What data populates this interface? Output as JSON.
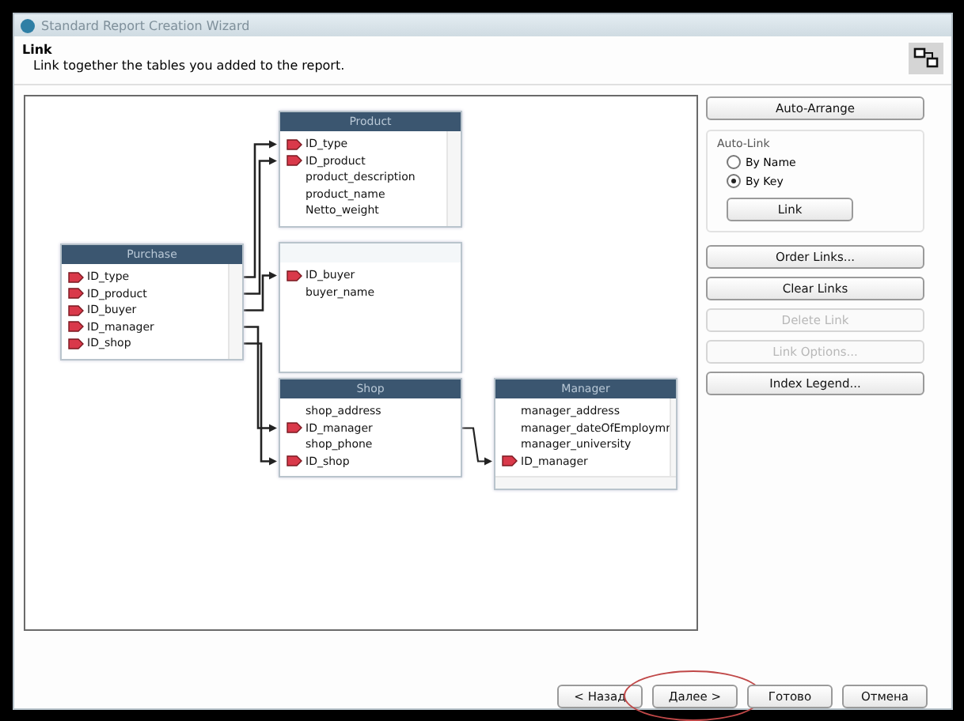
{
  "window": {
    "title": "Standard Report Creation Wizard"
  },
  "header": {
    "title": "Link",
    "subtitle": "Link together the tables you added to the report."
  },
  "tables": [
    {
      "title": "Product",
      "fields": [
        {
          "name": "ID_type",
          "key": true
        },
        {
          "name": "ID_product",
          "key": true
        },
        {
          "name": "product_description",
          "key": false
        },
        {
          "name": "product_name",
          "key": false
        },
        {
          "name": "Netto_weight",
          "key": false
        }
      ]
    },
    {
      "title": "Purchase",
      "fields": [
        {
          "name": "ID_type",
          "key": true
        },
        {
          "name": "ID_product",
          "key": true
        },
        {
          "name": "ID_buyer",
          "key": true
        },
        {
          "name": "ID_manager",
          "key": true
        },
        {
          "name": "ID_shop",
          "key": true
        }
      ]
    },
    {
      "fields": [
        {
          "name": "ID_buyer",
          "key": true
        },
        {
          "name": "buyer_name",
          "key": false
        }
      ]
    },
    {
      "title": "Shop",
      "fields": [
        {
          "name": "shop_address",
          "key": false
        },
        {
          "name": "ID_manager",
          "key": true
        },
        {
          "name": "shop_phone",
          "key": false
        },
        {
          "name": "ID_shop",
          "key": true
        }
      ]
    },
    {
      "title": "Manager",
      "fields": [
        {
          "name": "manager_address",
          "key": false
        },
        {
          "name": "manager_dateOfEmploymr",
          "key": false
        },
        {
          "name": "manager_university",
          "key": false
        },
        {
          "name": "ID_manager",
          "key": true
        }
      ]
    }
  ],
  "side_buttons_top": [
    {
      "label": "Auto-Arrange",
      "disabled": false
    }
  ],
  "auto_link": {
    "title": "Auto-Link",
    "options": [
      {
        "label": "By Name",
        "selected": false
      },
      {
        "label": "By Key",
        "selected": true
      }
    ],
    "button": "Link"
  },
  "side_buttons": [
    {
      "label": "Order Links...",
      "disabled": false
    },
    {
      "label": "Clear Links",
      "disabled": false
    },
    {
      "label": "Delete Link",
      "disabled": true
    },
    {
      "label": "Link Options...",
      "disabled": true
    },
    {
      "label": "Index Legend...",
      "disabled": false
    }
  ],
  "footer_buttons": [
    {
      "label": "< Назад",
      "highlighted": false
    },
    {
      "label": "Далее >",
      "highlighted": true
    },
    {
      "label": "Готово",
      "highlighted": false
    },
    {
      "label": "Отмена",
      "highlighted": false
    }
  ]
}
